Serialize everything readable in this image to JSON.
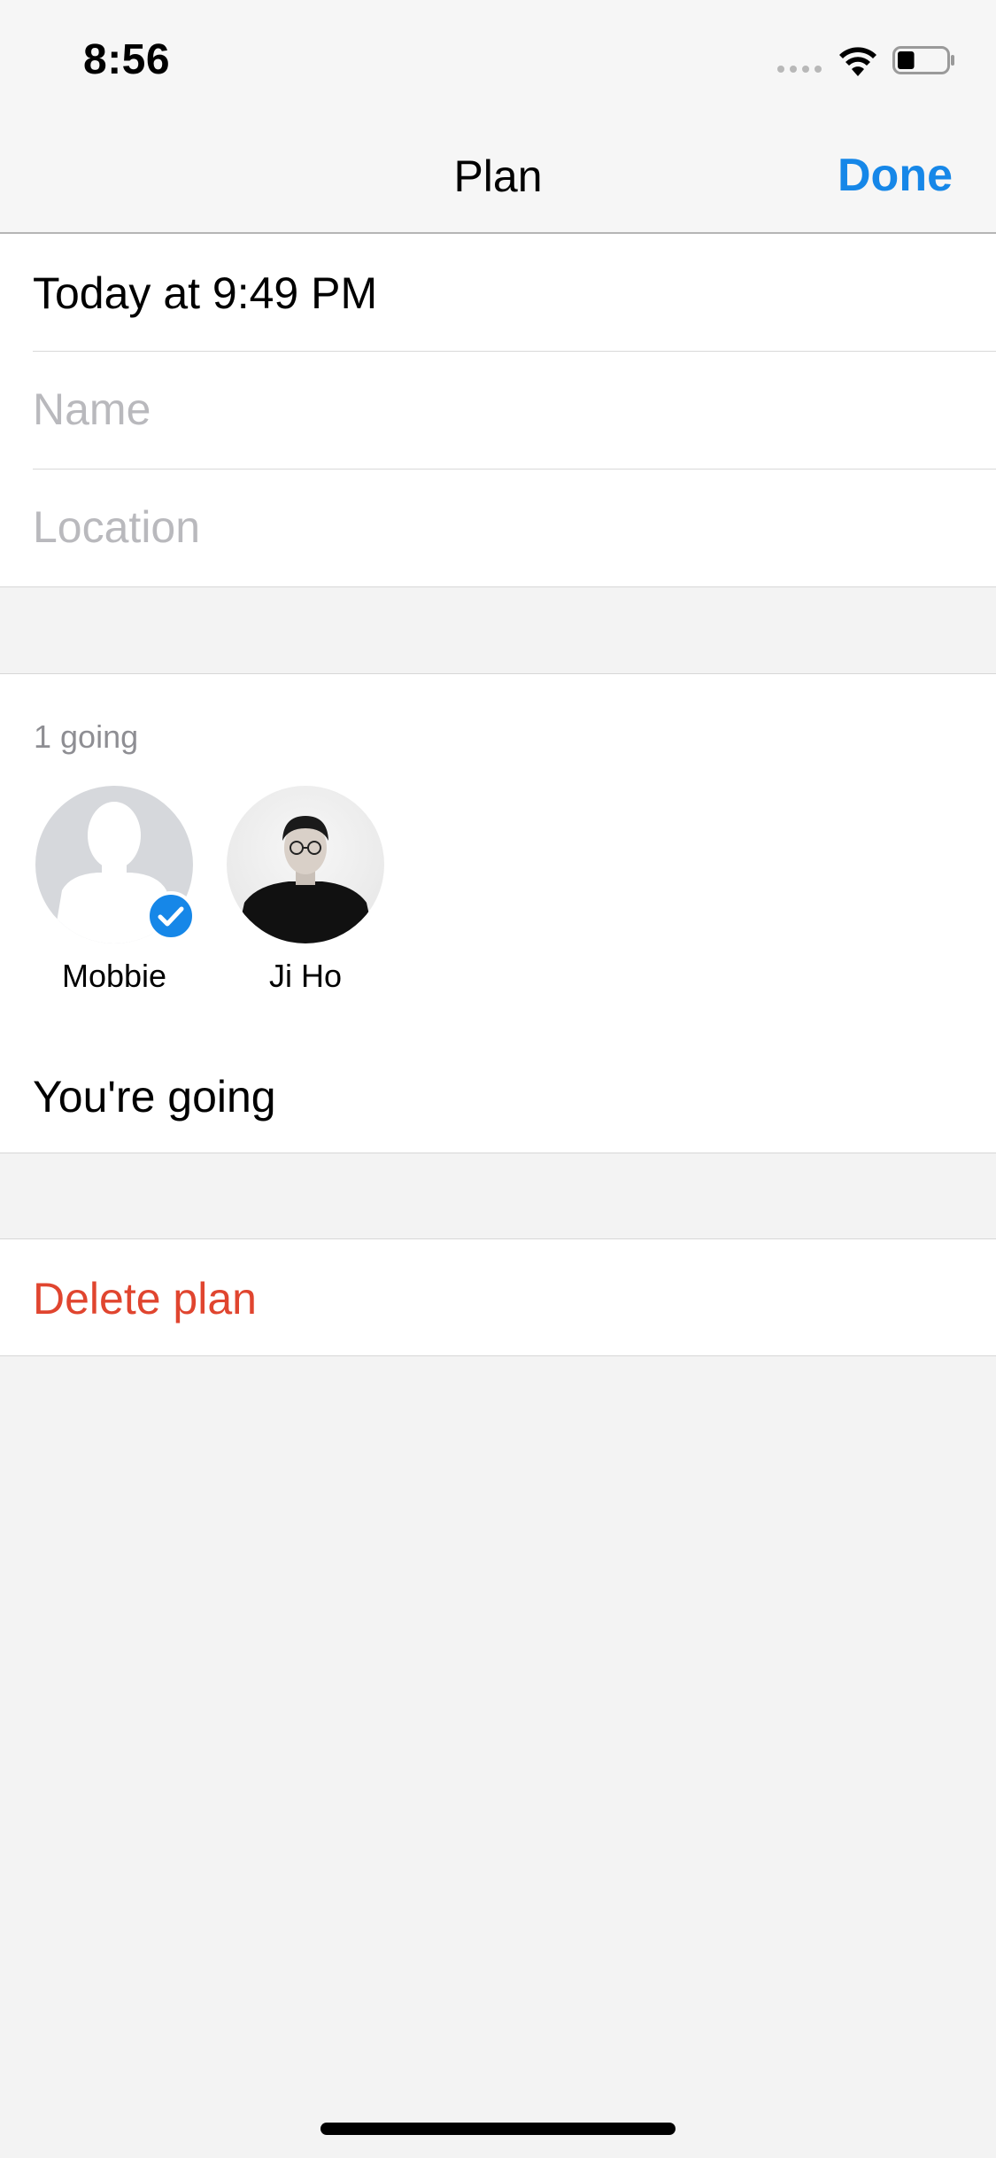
{
  "status_bar": {
    "time": "8:56",
    "icons": [
      "signal-icon",
      "wifi-icon",
      "battery-icon"
    ],
    "battery_level": 0.35
  },
  "nav": {
    "title": "Plan",
    "done_label": "Done"
  },
  "plan": {
    "datetime": "Today at 9:49 PM",
    "name_placeholder": "Name",
    "location_placeholder": "Location"
  },
  "attendance": {
    "going_count": "1 going",
    "attendees": [
      {
        "name": "Mobbie",
        "avatar": "default-avatar-icon",
        "going": true
      },
      {
        "name": "Ji Ho",
        "avatar": "user-photo",
        "going": false
      }
    ],
    "status": "You're going"
  },
  "actions": {
    "delete_label": "Delete plan"
  },
  "colors": {
    "accent": "#1687e8",
    "destructive": "#e0452f",
    "placeholder": "#b9b9bd",
    "secondary_text": "#8e8e93",
    "background": "#f3f3f3"
  }
}
